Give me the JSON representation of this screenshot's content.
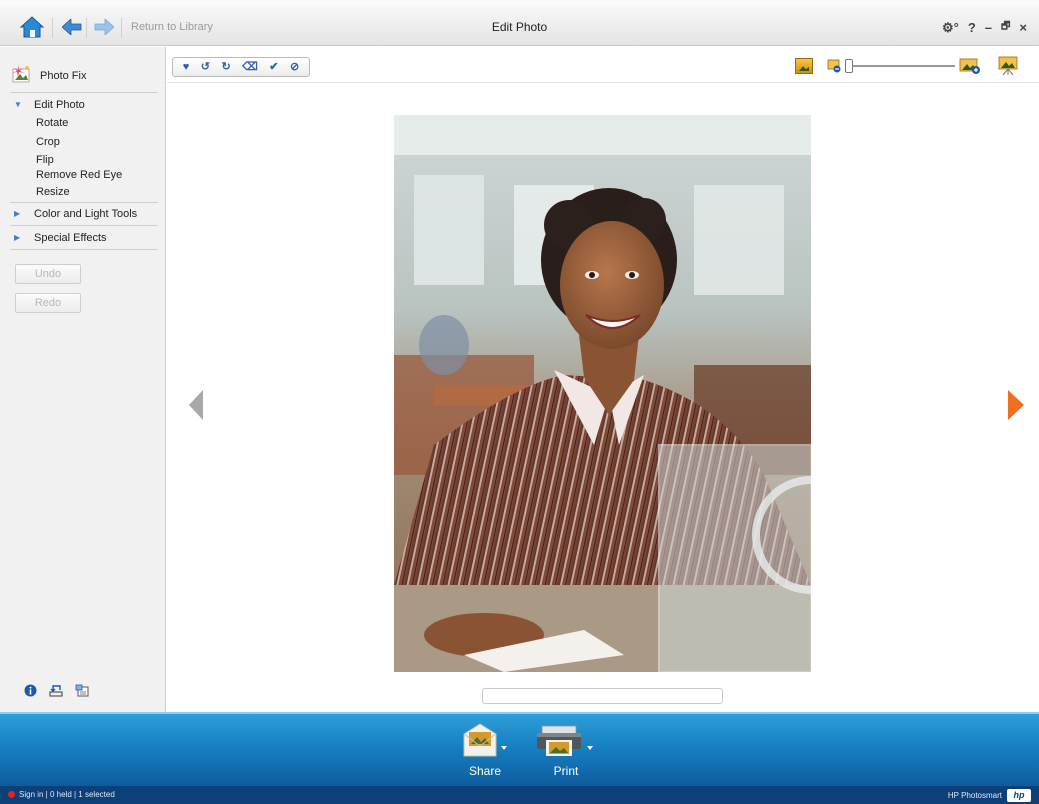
{
  "titlebar": {
    "return_label": "Return to Library",
    "title": "Edit Photo",
    "settings_glyph": "⚙°",
    "help_glyph": "?",
    "minimize_glyph": "–",
    "restore_glyph": "🗗",
    "close_glyph": "×"
  },
  "left_panel": {
    "header": "Photo Fix",
    "sections": [
      {
        "label": "Edit Photo",
        "expanded": true,
        "items": [
          "Rotate",
          "Crop",
          "Flip",
          "Remove Red Eye",
          "Resize"
        ]
      },
      {
        "label": "Color and Light Tools",
        "expanded": false
      },
      {
        "label": "Special Effects",
        "expanded": false
      }
    ],
    "undo_label": "Undo",
    "redo_label": "Redo",
    "bottom_icons": [
      "info-icon",
      "undo-history-icon",
      "export-icon"
    ]
  },
  "edit_toolbar": {
    "icons": [
      "heart-icon",
      "rotate-left-icon",
      "rotate-right-icon",
      "tag-icon",
      "checkmark-icon",
      "cancel-icon"
    ],
    "glyphs": [
      "♥",
      "↺",
      "↻",
      "⌫",
      "✔",
      "⊘"
    ]
  },
  "view_toolbar": {
    "icons": [
      "single-photo-view-icon",
      "zoom-out-icon",
      "zoom-in-icon",
      "slideshow-icon"
    ],
    "zoom_level": 0
  },
  "main": {
    "caption_placeholder": "",
    "photo_alt": "woman in striped shirt smiling in office"
  },
  "bottom_bar": {
    "share_label": "Share",
    "print_label": "Print"
  },
  "status": {
    "left_text": "Sign in | 0 held | 1 selected",
    "right_text": "HP Photosmart",
    "logo_text": "hp"
  },
  "colors": {
    "accent_orange": "#ee6f21",
    "bar_blue": "#1780c2",
    "status_blue": "#0d3f78"
  }
}
